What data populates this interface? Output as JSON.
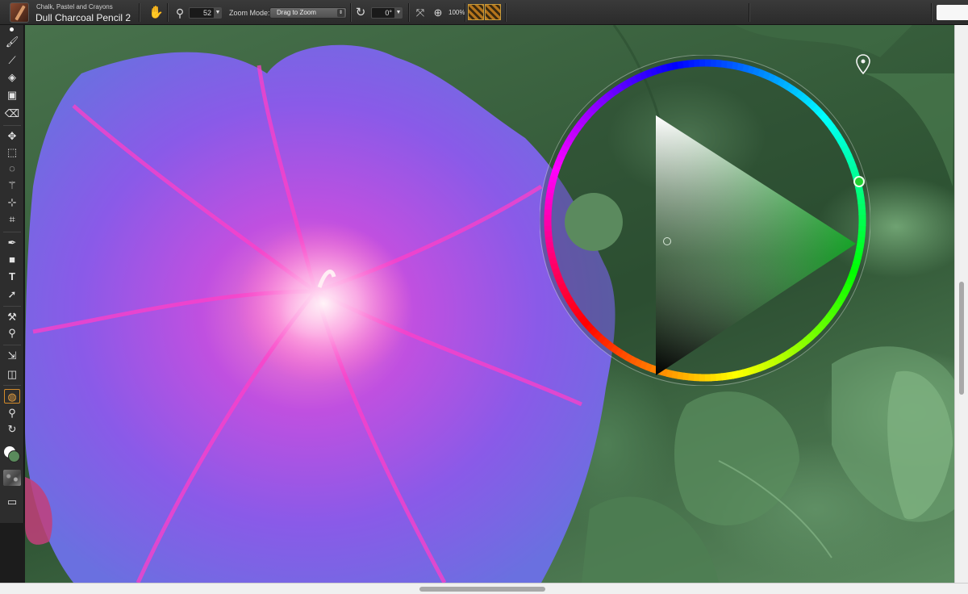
{
  "brush": {
    "category": "Chalk, Pastel and Crayons",
    "name": "Dull Charcoal Pencil 2"
  },
  "property_bar": {
    "size_value": "52",
    "zoom_mode_label": "Zoom Mode:",
    "zoom_mode_value": "Drag to Zoom",
    "rotation_value": "0°",
    "zoom_percent": "100%"
  },
  "colors": {
    "current_color": "#5b8a5e",
    "hue": "#00dd22",
    "accent": "#d28a2a"
  },
  "toolbox": {
    "tools": [
      "brush-tool",
      "dropper-tool",
      "paint-bucket-tool",
      "gradient-tool",
      "eraser-tool",
      "layer-adjuster-tool",
      "rectangle-select-tool",
      "lasso-tool",
      "magic-wand-tool",
      "transform-tool",
      "crop-tool",
      "pen-tool",
      "shape-tool",
      "text-tool",
      "shape-selection-tool",
      "cloner-tool",
      "rubber-stamp-tool",
      "divine-proportion-tool",
      "perspective-grid-tool",
      "mirror-tool",
      "magnifier-tool",
      "rotate-page-tool"
    ],
    "active_tool": "mirror-tool"
  }
}
